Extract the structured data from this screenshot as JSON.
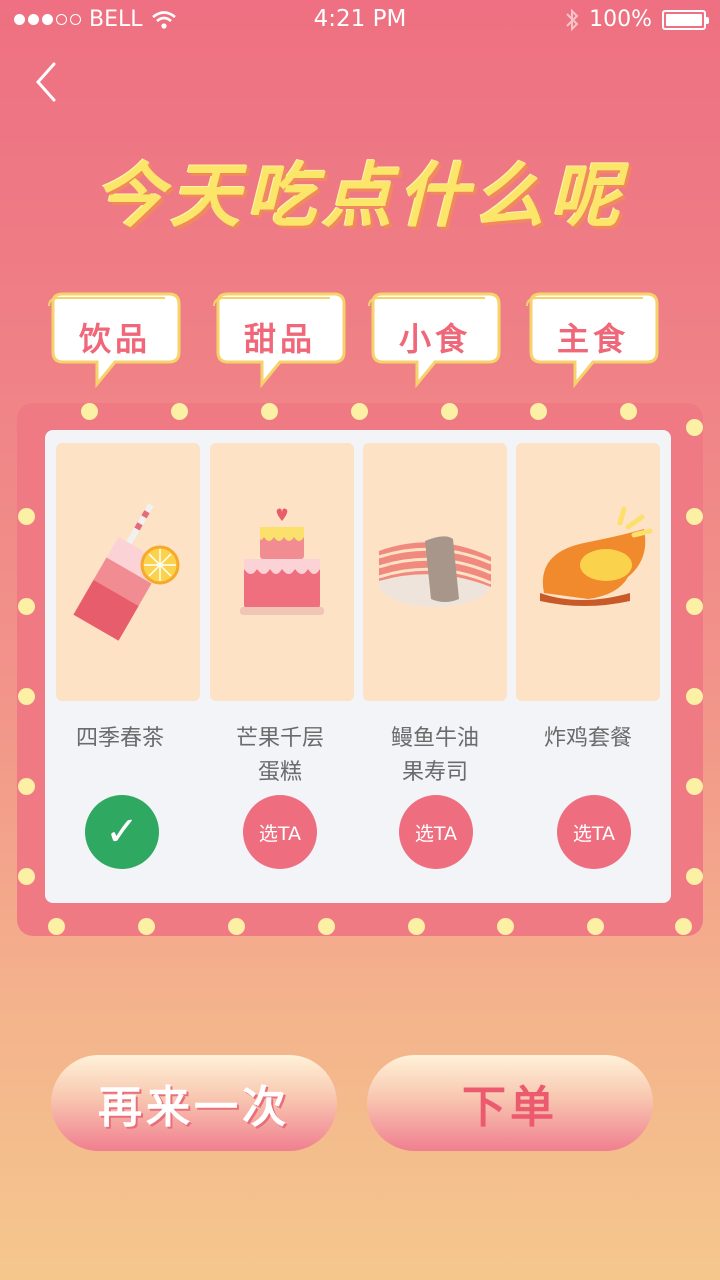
{
  "status_bar": {
    "carrier": "BELL",
    "time": "4:21 PM",
    "battery": "100%"
  },
  "header": {
    "title": "今天吃点什么呢"
  },
  "tabs": [
    {
      "label": "饮品"
    },
    {
      "label": "甜品"
    },
    {
      "label": "小食"
    },
    {
      "label": "主食"
    }
  ],
  "items": [
    {
      "name_line1": "四季春茶",
      "name_line2": "",
      "icon": "drink-icon",
      "action": "✓",
      "selected": true
    },
    {
      "name_line1": "芒果千层",
      "name_line2": "蛋糕",
      "icon": "cake-icon",
      "action": "选TA",
      "selected": false
    },
    {
      "name_line1": "鳗鱼牛油",
      "name_line2": "果寿司",
      "icon": "sushi-icon",
      "action": "选TA",
      "selected": false
    },
    {
      "name_line1": "炸鸡套餐",
      "name_line2": "",
      "icon": "fried-chicken-icon",
      "action": "选TA",
      "selected": false
    }
  ],
  "buttons": {
    "again_label": "再来一次",
    "order_label": "下单"
  },
  "colors": {
    "accent": "#ee6e80",
    "selected": "#2fa862",
    "title": "#fbe66a",
    "bulb": "#fbf0a4"
  }
}
